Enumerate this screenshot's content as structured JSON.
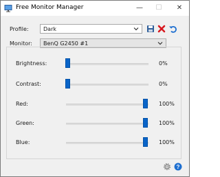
{
  "window": {
    "title": "Free Monitor Manager",
    "controls": {
      "minimize": "—",
      "maximize": "☐",
      "close": "✕"
    }
  },
  "profile": {
    "label": "Profile:",
    "selected": "Dark",
    "actions": {
      "save_icon": "save-icon",
      "delete_icon": "delete-icon",
      "undo_icon": "undo-icon"
    }
  },
  "monitor": {
    "label": "Monitor:",
    "selected": "BenQ G2450 #1"
  },
  "sliders": [
    {
      "label": "Brightness:",
      "value": 0,
      "display": "0%"
    },
    {
      "label": "Contrast:",
      "value": 0,
      "display": "0%"
    },
    {
      "label": "Red:",
      "value": 100,
      "display": "100%"
    },
    {
      "label": "Green:",
      "value": 100,
      "display": "100%"
    },
    {
      "label": "Blue:",
      "value": 100,
      "display": "100%"
    }
  ],
  "footer": {
    "settings_icon": "settings-icon",
    "help_icon": "help-icon"
  },
  "colors": {
    "accent": "#0a64c8",
    "delete_red": "#d71920",
    "undo_blue": "#1e6fd0"
  }
}
